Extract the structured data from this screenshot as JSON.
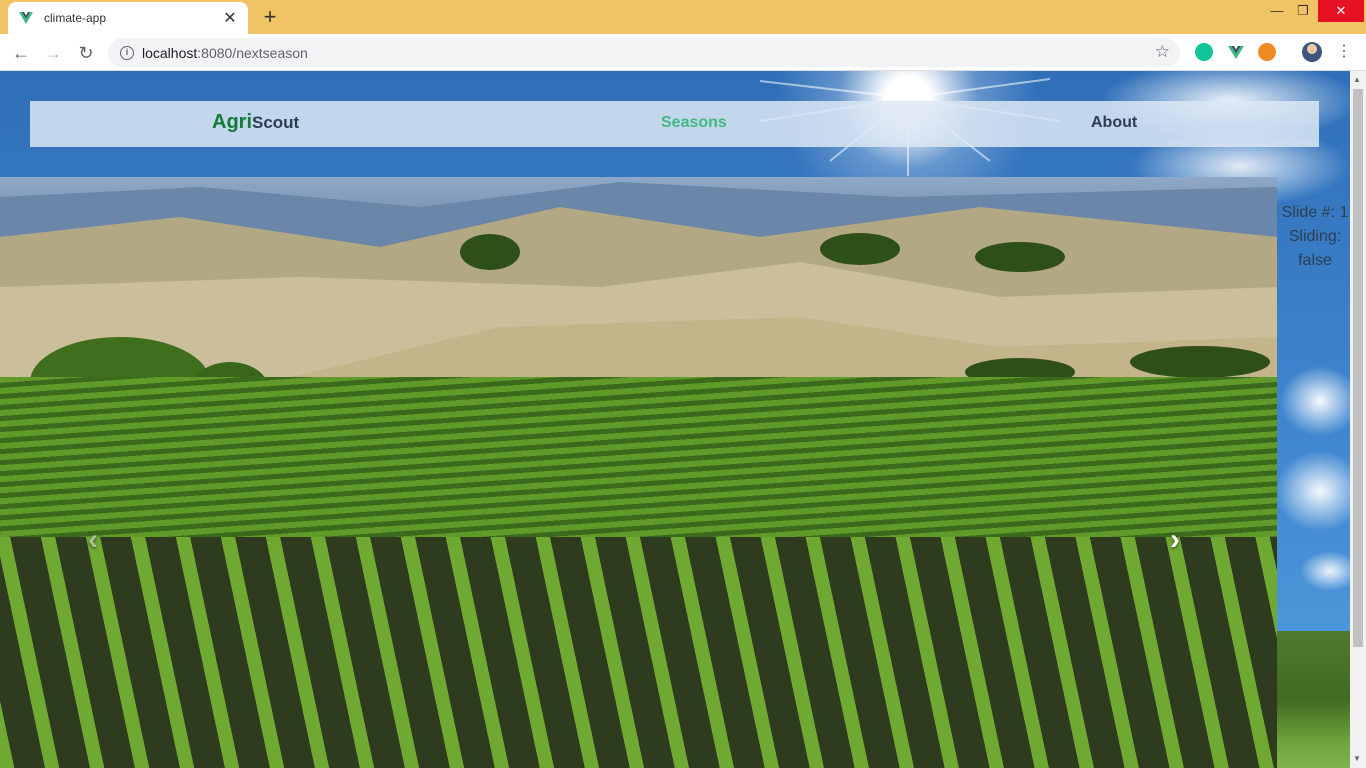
{
  "browser": {
    "tab_title": "climate-app",
    "tab_close": "✕",
    "new_tab": "+",
    "url_host": "localhost",
    "url_path": ":8080/nextseason",
    "window_controls": {
      "minimize": "—",
      "restore": "❐",
      "close": "✕"
    },
    "extensions": [
      "grammarly-icon",
      "vue-devtools-icon",
      "extension-icon"
    ]
  },
  "navbar": {
    "brand_agri": "Agri",
    "brand_scout": "Scout",
    "links": [
      "Seasons",
      "About"
    ]
  },
  "carousel": {
    "prev_label": "‹",
    "next_label": "›",
    "slide_status": "Slide #: 1",
    "sliding_status": "Sliding:",
    "sliding_value": "false"
  },
  "colors": {
    "brand_green": "#157a35",
    "active_link": "#42b983",
    "text_dark": "#2c3e50",
    "chrome_tabbar": "#f0c365"
  }
}
